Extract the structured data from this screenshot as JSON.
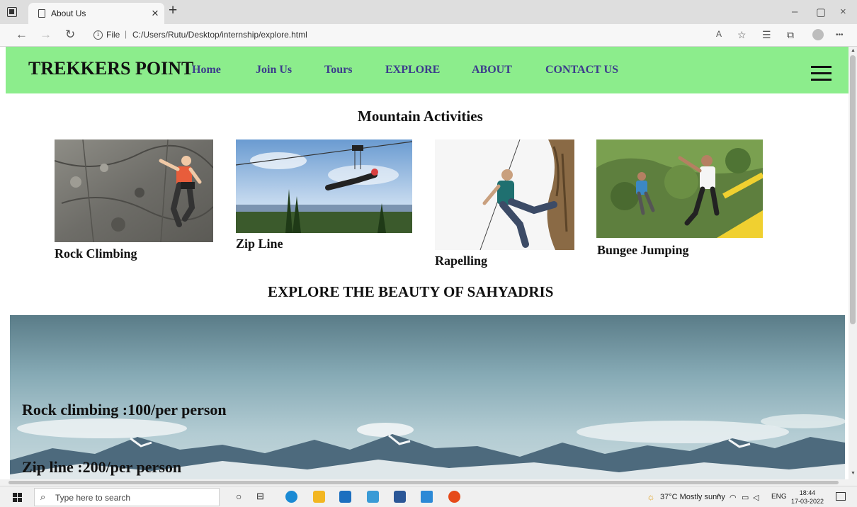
{
  "browser": {
    "tab_title": "About Us",
    "tab_close": "×",
    "new_tab": "+",
    "window_controls": [
      "–",
      "▢",
      "×"
    ],
    "nav": {
      "back": "←",
      "forward": "→",
      "reload": "↻"
    },
    "url_scheme": "File",
    "url_separator": "|",
    "url_path": "C:/Users/Rutu/Desktop/internship/explore.html",
    "toolbar_icons": [
      "read-aloud-icon",
      "add-favorite-icon",
      "favorites-icon",
      "collections-icon",
      "profile-icon",
      "more-icon"
    ],
    "toolbar_glyphs": [
      "A",
      "☆",
      "☰",
      "⧉",
      "•••"
    ]
  },
  "site": {
    "brand": "TREKKERS POINT",
    "nav_links": [
      "Home",
      "Join Us",
      "Tours",
      "EXPLORE",
      "ABOUT",
      "CONTACT US"
    ],
    "section_title": "Mountain Activities",
    "activities": [
      {
        "name": "Rock Climbing"
      },
      {
        "name": "Zip Line"
      },
      {
        "name": "Rapelling"
      },
      {
        "name": "Bungee Jumping"
      }
    ],
    "explore_title": "EXPLORE THE BEAUTY OF SAHYADRIS",
    "prices": [
      "Rock climbing :100/per person",
      "Zip line :200/per person"
    ]
  },
  "taskbar": {
    "search_placeholder": "Type here to search",
    "weather": "37°C  Mostly sunny",
    "tray_lang": "ENG",
    "tray_up": "^",
    "time": "18:44",
    "date": "17-03-2022"
  },
  "colors": {
    "navbar": "#8ced8c",
    "nav_link": "#3c3c8c"
  }
}
